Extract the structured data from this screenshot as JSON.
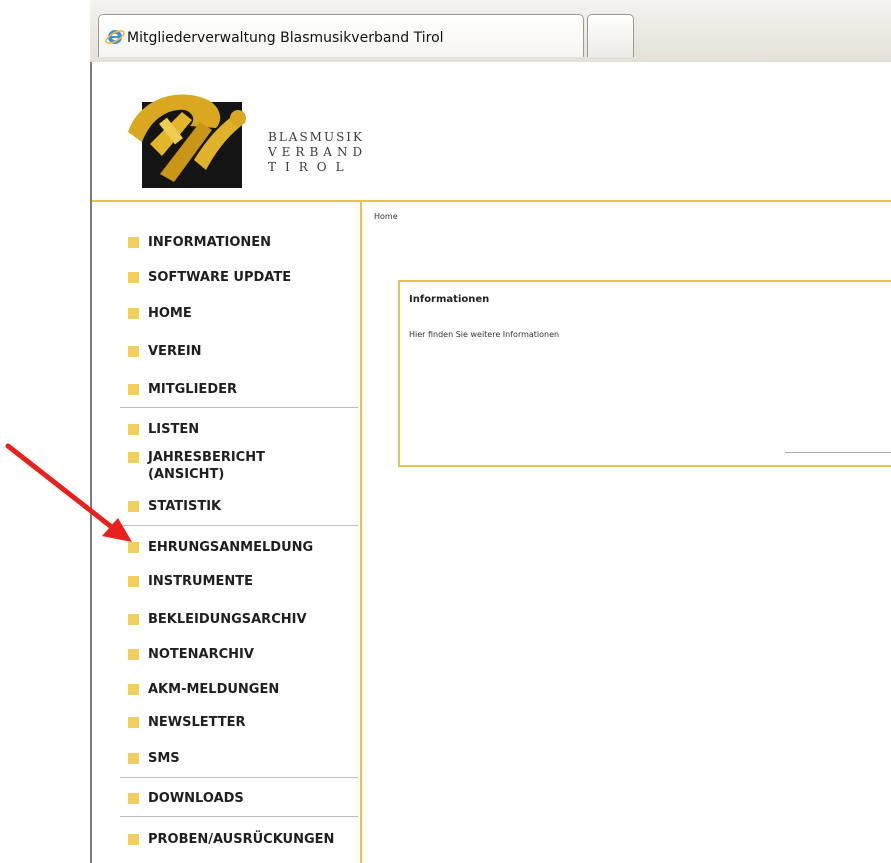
{
  "browser": {
    "tab_title": "Mitgliederverwaltung Blasmusikverband Tirol"
  },
  "logo": {
    "line1": "BLASMUSIK",
    "line2": "VERBAND",
    "line3": "TIROL"
  },
  "breadcrumb": "Home",
  "sidebar": {
    "items": [
      {
        "label": "INFORMATIONEN"
      },
      {
        "label": "SOFTWARE UPDATE"
      },
      {
        "label": "HOME"
      },
      {
        "label": "VEREIN"
      },
      {
        "label": "MITGLIEDER"
      },
      {
        "label": "LISTEN"
      },
      {
        "label": "JAHRESBERICHT"
      },
      {
        "label": "(ANSICHT)"
      },
      {
        "label": "STATISTIK"
      },
      {
        "label": "EHRUNGSANMELDUNG"
      },
      {
        "label": "INSTRUMENTE"
      },
      {
        "label": "BEKLEIDUNGSARCHIV"
      },
      {
        "label": "NOTENARCHIV"
      },
      {
        "label": "AKM-MELDUNGEN"
      },
      {
        "label": "NEWSLETTER"
      },
      {
        "label": "SMS"
      },
      {
        "label": "DOWNLOADS"
      },
      {
        "label": "PROBEN/AUSRÜCKUNGEN"
      }
    ]
  },
  "info_panel": {
    "title": "Informationen",
    "text": "Hier finden Sie weitere Informationen"
  },
  "colors": {
    "accent": "#e5c44e",
    "bullet": "#f0cf5a",
    "annotation_arrow": "#e8211d"
  }
}
